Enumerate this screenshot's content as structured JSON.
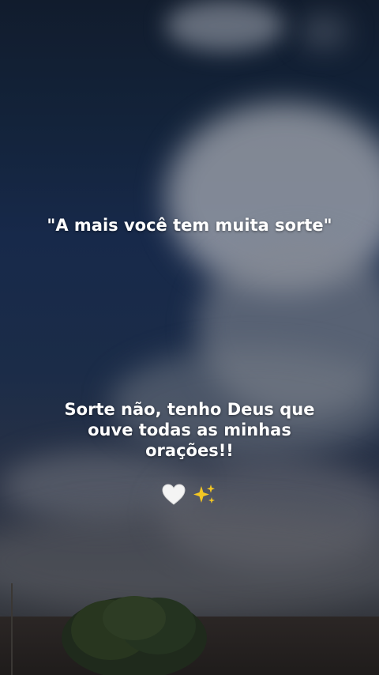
{
  "quote_text": "\"A mais você tem muita sorte\"",
  "answer_text": "Sorte não, tenho Deus que ouve todas as minhas orações!!",
  "emojis": [
    "white-heart-icon",
    "sparkles-icon"
  ],
  "colors": {
    "text": "#ffffff",
    "sky_top": "#111c2d",
    "sky_mid": "#17294a",
    "sparkle": "#f3c623"
  }
}
